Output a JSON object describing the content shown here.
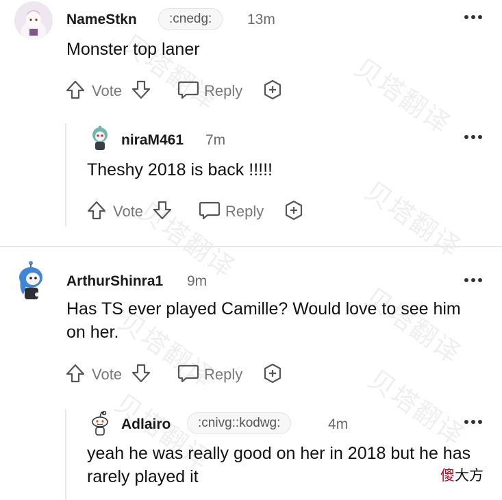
{
  "comments": [
    {
      "username": "NameStkn",
      "flair": ":cnedg:",
      "time": "13m",
      "body": "Monster top laner",
      "actions": {
        "vote": "Vote",
        "reply": "Reply"
      }
    },
    {
      "username": "niraM461",
      "flair": "",
      "time": "7m",
      "body": "Theshy 2018 is back !!!!!",
      "actions": {
        "vote": "Vote",
        "reply": "Reply"
      }
    },
    {
      "username": "ArthurShinra1",
      "flair": "",
      "time": "9m",
      "body": "Has TS ever played Camille? Would love to see him on her.",
      "actions": {
        "vote": "Vote",
        "reply": "Reply"
      }
    },
    {
      "username": "Adlairo",
      "flair": ":cnivg::kodwg:",
      "time": "4m",
      "body": "yeah he was really good on her in 2018 but he has rarely played it",
      "actions": {}
    }
  ],
  "watermark": "贝塔翻译",
  "corner_stamp": {
    "red": "傻",
    "black": "大方"
  },
  "icons": [
    "upvote-icon",
    "downvote-icon",
    "comment-icon",
    "award-plus-icon",
    "more-options-icon"
  ],
  "colors": {
    "text": "#1a1a1b",
    "muted": "#777777",
    "stamp_red": "#d0021b"
  }
}
